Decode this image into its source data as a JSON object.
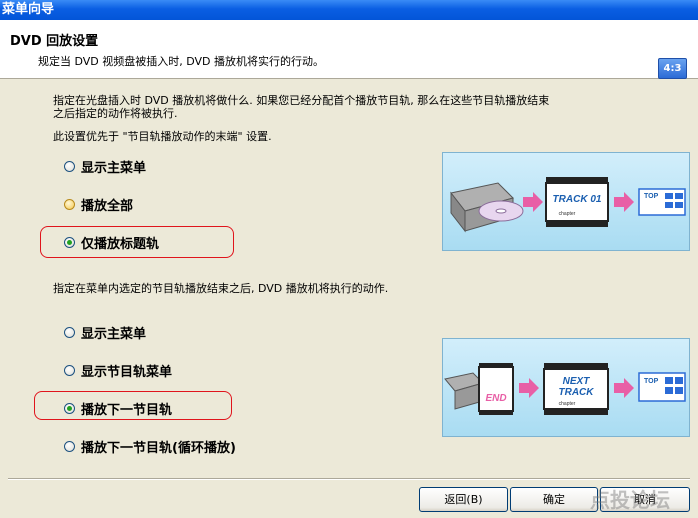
{
  "window": {
    "title": "菜单向导"
  },
  "header": {
    "title": "DVD 回放设置",
    "subtitle": "规定当 DVD 视频盘被插入时, DVD 播放机将实行的行动。",
    "badge": "4:3"
  },
  "section1": {
    "desc_line1": "指定在光盘插入时 DVD 播放机将做什么. 如果您已经分配首个播放节目轨, 那么在这些节目轨播放结束",
    "desc_line2": "之后指定的动作将被执行.",
    "note": "此设置优先于 \"节目轨播放动作的末端\" 设置.",
    "options": [
      {
        "label": "显示主菜单",
        "selected": false
      },
      {
        "label": "播放全部",
        "selected": false
      },
      {
        "label": "仅播放标题轨",
        "selected": true
      }
    ]
  },
  "section2": {
    "desc": "指定在菜单内选定的节目轨播放结束之后, DVD 播放机将执行的动作.",
    "options": [
      {
        "label": "显示主菜单",
        "selected": false
      },
      {
        "label": "显示节目轨菜单",
        "selected": false
      },
      {
        "label": "播放下一节目轨",
        "selected": true
      },
      {
        "label": "播放下一节目轨(循环播放)",
        "selected": false
      }
    ]
  },
  "illustration1": {
    "track_text": "TRACK 01",
    "chapter_text": "chapter",
    "top_text": "TOP"
  },
  "illustration2": {
    "end_text": "END",
    "next_text": "NEXT",
    "track_text": "TRACK",
    "chapter_text": "chapter",
    "top_text": "TOP"
  },
  "buttons": {
    "back": "返回(B)",
    "ok": "确定",
    "cancel": "取消"
  },
  "watermark": "点投论坛",
  "colors": {
    "highlight": "#e0141c",
    "titlebar": "#0a5ee3",
    "selected_dot": "#21a121"
  }
}
